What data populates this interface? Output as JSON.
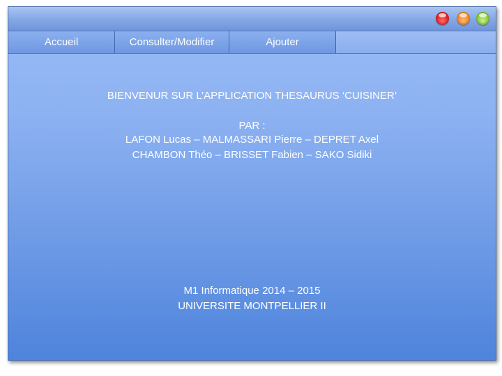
{
  "window": {
    "controls": {
      "close_icon": "close-icon",
      "minimize_icon": "minimize-icon",
      "maximize_icon": "maximize-icon",
      "colors": {
        "close": "#e11f1f",
        "minimize": "#f5861e",
        "maximize": "#86c936"
      }
    }
  },
  "tabs": [
    {
      "label": "Accueil"
    },
    {
      "label": "Consulter/Modifier"
    },
    {
      "label": "Ajouter"
    }
  ],
  "main": {
    "welcome": "BIENVENUR SUR L’APPLICATION THESAURUS ‘CUISINER’",
    "by_label": "PAR :",
    "authors_line1": "LAFON Lucas – MALMASSARI Pierre – DEPRET Axel",
    "authors_line2": "CHAMBON Théo – BRISSET Fabien – SAKO Sidiki",
    "course": "M1 Informatique 2014 – 2015",
    "university": "UNIVERSITE MONTPELLIER II"
  },
  "colors": {
    "accent": "#6f98e2",
    "text": "#ffffff"
  }
}
